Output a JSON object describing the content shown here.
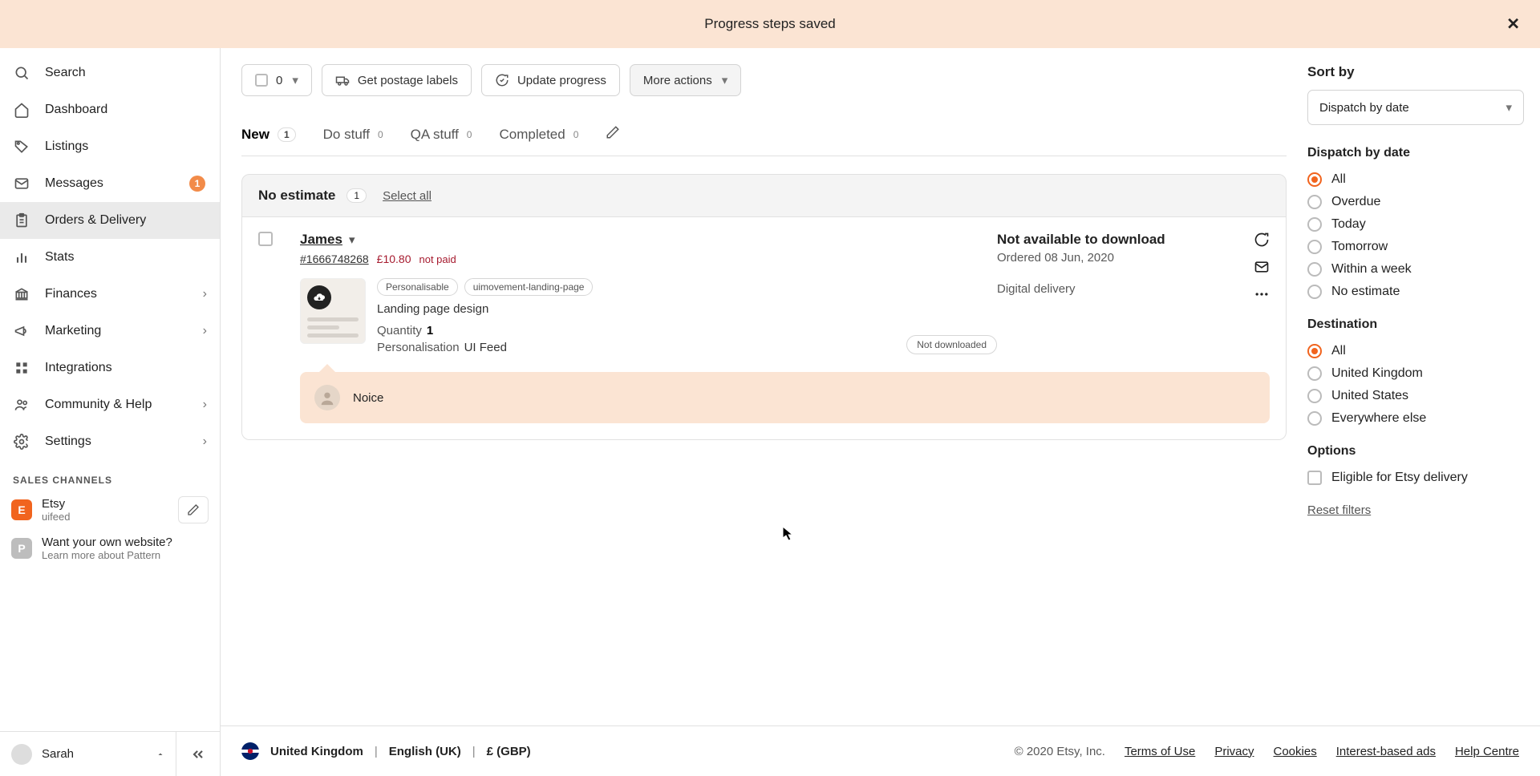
{
  "toast": {
    "message": "Progress steps saved"
  },
  "sidebar": {
    "items": [
      {
        "label": "Search"
      },
      {
        "label": "Dashboard"
      },
      {
        "label": "Listings"
      },
      {
        "label": "Messages",
        "badge": "1"
      },
      {
        "label": "Orders & Delivery"
      },
      {
        "label": "Stats"
      },
      {
        "label": "Finances"
      },
      {
        "label": "Marketing"
      },
      {
        "label": "Integrations"
      },
      {
        "label": "Community & Help"
      },
      {
        "label": "Settings"
      }
    ],
    "section_label": "SALES CHANNELS",
    "channels": [
      {
        "initial": "E",
        "title": "Etsy",
        "sub": "uifeed"
      },
      {
        "initial": "P",
        "title": "Want your own website?",
        "sub": "Learn more about Pattern"
      }
    ],
    "user": {
      "name": "Sarah"
    }
  },
  "toolbar": {
    "selected_count": "0",
    "postage_label": "Get postage labels",
    "update_label": "Update progress",
    "more_label": "More actions"
  },
  "tabs": [
    {
      "label": "New",
      "count": "1",
      "active": true
    },
    {
      "label": "Do stuff",
      "count": "0"
    },
    {
      "label": "QA stuff",
      "count": "0"
    },
    {
      "label": "Completed",
      "count": "0"
    }
  ],
  "group": {
    "title": "No estimate",
    "count": "1",
    "select_all": "Select all"
  },
  "order": {
    "buyer": "James",
    "id": "#1666748268",
    "price": "£10.80",
    "paid_status": "not paid",
    "tags": [
      "Personalisable",
      "uimovement-landing-page"
    ],
    "product_title": "Landing page design",
    "qty_label": "Quantity",
    "qty_value": "1",
    "pers_label": "Personalisation",
    "pers_value": "UI Feed",
    "download_status": "Not available to download",
    "ordered_label": "Ordered 08 Jun, 2020",
    "delivery_type": "Digital delivery",
    "download_pill": "Not downloaded",
    "note": "Noice"
  },
  "sort": {
    "title": "Sort by",
    "selected": "Dispatch by date"
  },
  "filters": {
    "dispatch": {
      "label": "Dispatch by date",
      "options": [
        "All",
        "Overdue",
        "Today",
        "Tomorrow",
        "Within a week",
        "No estimate"
      ],
      "selected": "All"
    },
    "destination": {
      "label": "Destination",
      "options": [
        "All",
        "United Kingdom",
        "United States",
        "Everywhere else"
      ],
      "selected": "All"
    },
    "options": {
      "label": "Options",
      "eligible": "Eligible for Etsy delivery"
    },
    "reset": "Reset filters"
  },
  "footer": {
    "country": "United Kingdom",
    "language": "English (UK)",
    "currency": "£ (GBP)",
    "copyright": "© 2020 Etsy, Inc.",
    "links": [
      "Terms of Use",
      "Privacy",
      "Cookies",
      "Interest-based ads",
      "Help Centre"
    ]
  }
}
